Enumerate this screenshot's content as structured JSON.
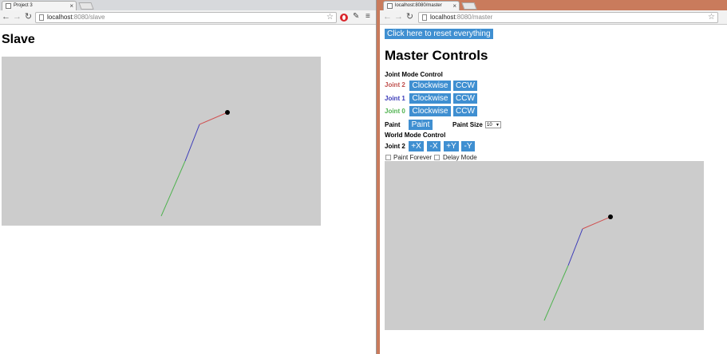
{
  "left_window": {
    "tab_title": "Project 3",
    "url_host": "localhost",
    "url_path": ":8080/slave",
    "page_title": "Slave"
  },
  "right_window": {
    "tab_title": "localhost:8080/master",
    "url_host": "localhost",
    "url_path": ":8080/master",
    "reset_button": "Click here to reset everything",
    "page_title": "Master Controls",
    "joint_mode_heading": "Joint Mode Control",
    "joints": [
      {
        "label": "Joint 2",
        "color": "#c0504d",
        "cw": "Clockwise",
        "ccw": "CCW"
      },
      {
        "label": "Joint 1",
        "color": "#3a3ab8",
        "cw": "Clockwise",
        "ccw": "CCW"
      },
      {
        "label": "Joint 0",
        "color": "#4fb24f",
        "cw": "Clockwise",
        "ccw": "CCW"
      }
    ],
    "paint_label": "Paint",
    "paint_button": "Paint",
    "paint_size_label": "Paint Size",
    "paint_size_value": "10",
    "world_mode_heading": "World Mode Control",
    "world_joint_label": "Joint 2",
    "world_buttons": [
      "+X",
      "-X",
      "+Y",
      "-Y"
    ],
    "paint_forever_label": "Paint Forever",
    "delay_mode_label": "Delay Mode"
  },
  "colors": {
    "button_blue": "#3f8fd1",
    "canvas_gray": "#cccccc",
    "arm_red": "#d05050",
    "arm_blue": "#3a3ab8",
    "arm_green": "#4fb24f",
    "end_effector": "#000000"
  },
  "icons": [
    "back-arrow-icon",
    "forward-arrow-icon",
    "reload-icon",
    "bookmark-star-icon",
    "opera-extension-icon",
    "pencil-icon",
    "menu-icon",
    "page-icon",
    "close-icon"
  ]
}
